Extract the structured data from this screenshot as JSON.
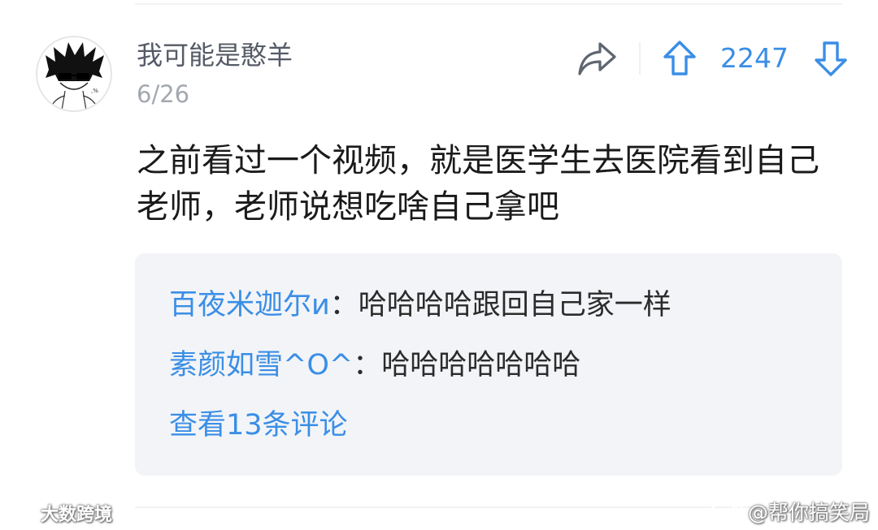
{
  "comment": {
    "username": "我可能是憨羊",
    "date": "6/26",
    "vote_count": "2247",
    "text": "之前看过一个视频，就是医学生去医院看到自己老师，老师说想吃啥自己拿吧"
  },
  "replies": [
    {
      "author": "百夜米迦尔и",
      "separator": "：",
      "text": "哈哈哈哈跟回自己家一样"
    },
    {
      "author": "素颜如雪^O^",
      "separator": "：",
      "text": "哈哈哈哈哈哈哈"
    }
  ],
  "view_more_label": "查看13条评论",
  "watermarks": {
    "left": "大数跨境",
    "right": "@帮你搞笑局"
  },
  "colors": {
    "accent": "#3a8ee6",
    "reply_box_bg": "#f2f4f7",
    "username": "#555b66",
    "date": "#a3a8b0",
    "body_text": "#1a1a1a"
  },
  "icons": {
    "share": "share-icon",
    "upvote": "arrow-up-icon",
    "downvote": "arrow-down-icon"
  }
}
